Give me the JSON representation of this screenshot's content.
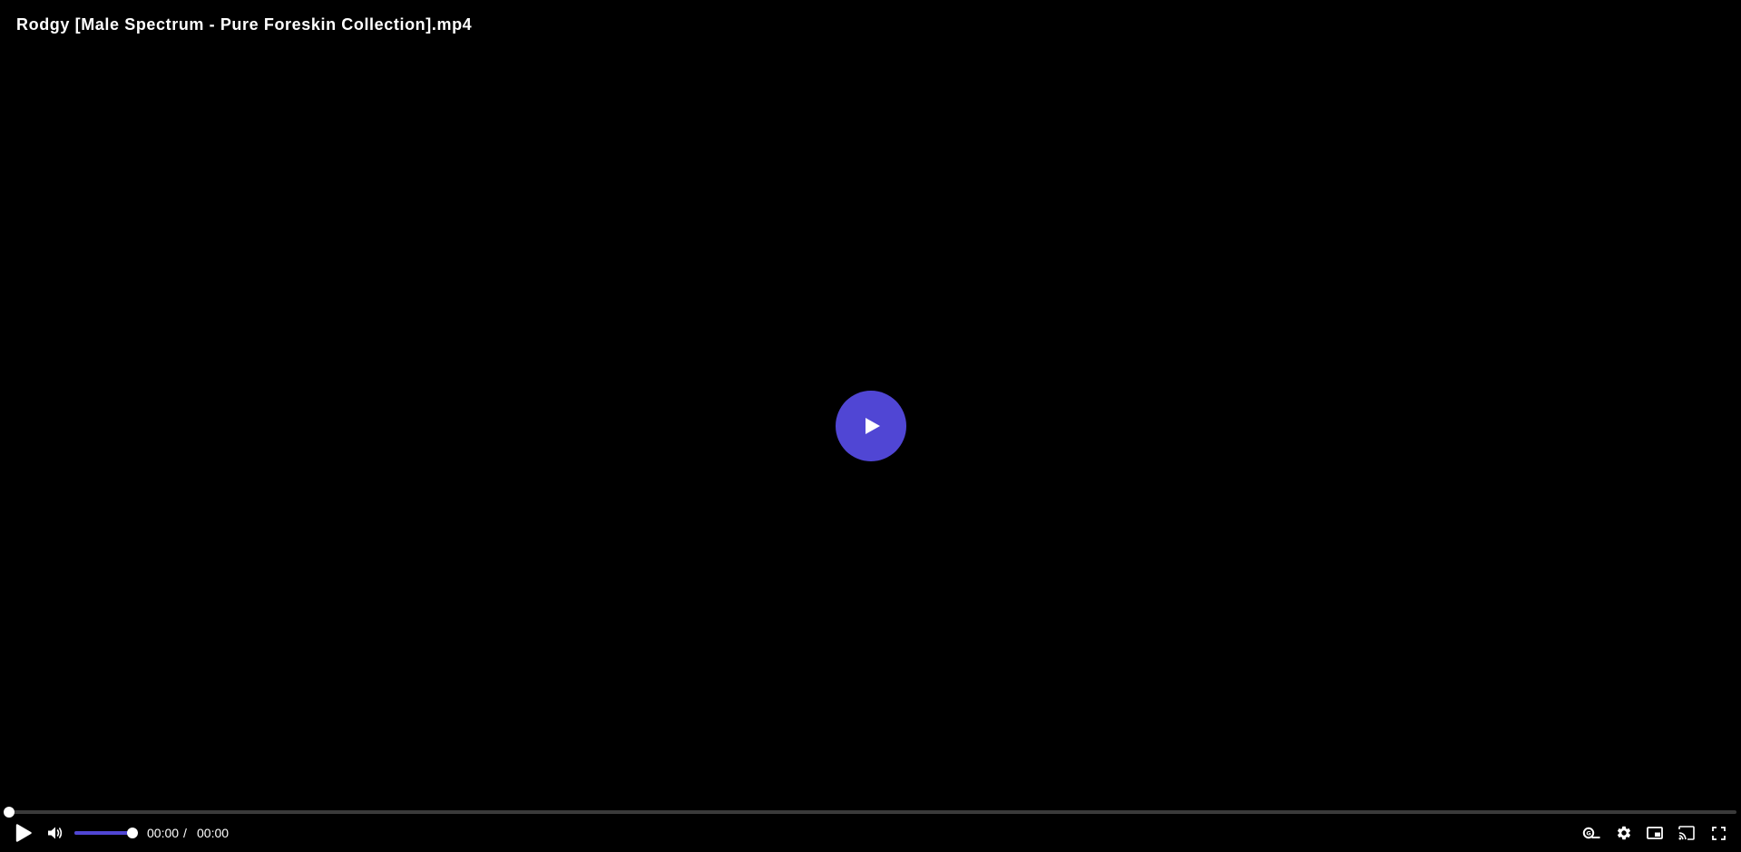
{
  "video": {
    "title": "Rodgy [Male Spectrum - Pure Foreskin Collection].mp4"
  },
  "colors": {
    "accent": "#5046d4",
    "background": "#000000",
    "text": "#ffffff"
  },
  "playback": {
    "current_time": "00:00",
    "separator": "/",
    "duration": "00:00",
    "progress_fraction": 0.0
  },
  "volume": {
    "level_fraction": 1.0
  },
  "icons": {
    "big_play": "play-icon",
    "play": "play-icon",
    "volume": "volume-icon",
    "captions": "captions-icon",
    "settings": "gear-icon",
    "pip": "picture-in-picture-icon",
    "cast": "cast-icon",
    "fullscreen": "fullscreen-icon"
  }
}
